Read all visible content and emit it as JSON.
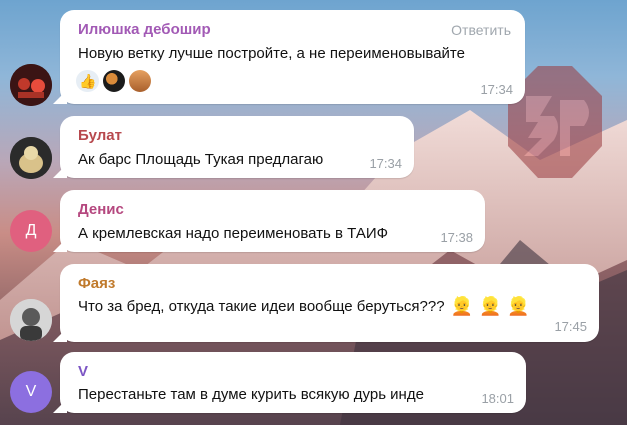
{
  "messages": [
    {
      "sender": "Илюшка дебошир",
      "sender_color": "#a25ab5",
      "text": "Новую ветку лучше постройте, а не переименовывайте",
      "reply_label": "Ответить",
      "time": "17:34",
      "reactions": [
        "thumbs-up",
        "avatar-1",
        "avatar-2"
      ]
    },
    {
      "sender": "Булат",
      "sender_color": "#b7494e",
      "text": "Ак барс Площадь Тукая предлагаю",
      "time": "17:34"
    },
    {
      "sender": "Денис",
      "sender_color": "#b5487f",
      "avatar_letter": "Д",
      "text": "А кремлевская надо переименовать в ТАИФ",
      "time": "17:38"
    },
    {
      "sender": "Фаяз",
      "sender_color": "#c07a2c",
      "text": "Что за бред, откуда такие идеи вообще беруться???",
      "emojis": [
        "person-blond-icon",
        "person-blond-icon",
        "person-blond-icon"
      ],
      "time": "17:45"
    },
    {
      "sender": "V",
      "sender_color": "#7c55c4",
      "avatar_letter": "V",
      "text": "Перестаньте там в думе курить всякую дурь инде",
      "time": "18:01"
    }
  ],
  "colors": {
    "avatar_d": "#e0607f",
    "avatar_v": "#8c6fe0"
  }
}
